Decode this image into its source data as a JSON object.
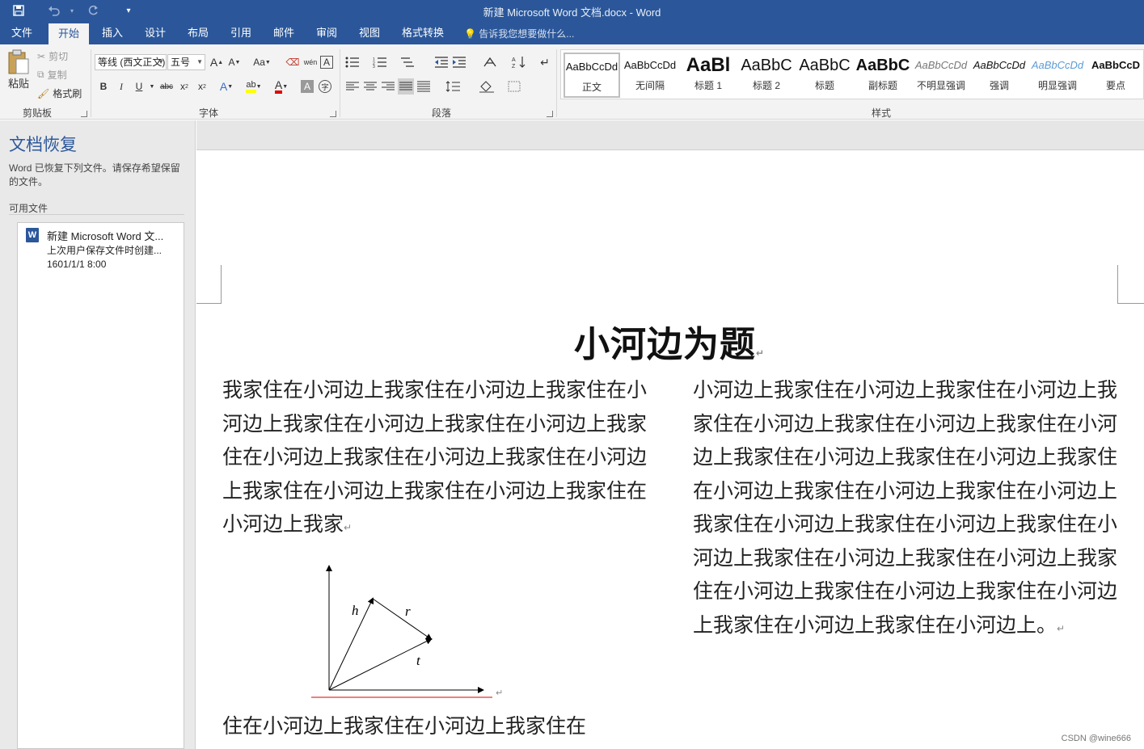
{
  "titlebar": {
    "title": "新建 Microsoft Word 文档.docx - Word",
    "save_icon": "save-icon",
    "undo_icon": "undo-icon",
    "redo_icon": "redo-icon"
  },
  "tabs": [
    "文件",
    "开始",
    "插入",
    "设计",
    "布局",
    "引用",
    "邮件",
    "审阅",
    "视图",
    "格式转换"
  ],
  "tell_me": "告诉我您想要做什么...",
  "ribbon": {
    "clipboard": {
      "label": "剪贴板",
      "paste": "粘贴",
      "cut": "剪切",
      "copy": "复制",
      "format_painter": "格式刷"
    },
    "font": {
      "label": "字体",
      "font_name": "等线 (西文正文)",
      "font_size": "五号",
      "grow": "A",
      "shrink": "A",
      "change_case": "Aa",
      "phonetic": "wén",
      "char_border": "A",
      "bold": "B",
      "italic": "I",
      "underline": "U",
      "strike": "abc",
      "subscript": "x",
      "superscript": "x",
      "highlight": "ab",
      "font_color": "A",
      "char_shading": "A",
      "enclosed": "字"
    },
    "paragraph": {
      "label": "段落"
    },
    "styles": {
      "label": "样式",
      "items": [
        {
          "preview": "AaBbCcDd",
          "name": "正文"
        },
        {
          "preview": "AaBbCcDd",
          "name": "无间隔"
        },
        {
          "preview": "AaBl",
          "name": "标题 1"
        },
        {
          "preview": "AaBbC",
          "name": "标题 2"
        },
        {
          "preview": "AaBbC",
          "name": "标题"
        },
        {
          "preview": "AaBbC",
          "name": "副标题"
        },
        {
          "preview": "AaBbCcDd",
          "name": "不明显强调"
        },
        {
          "preview": "AaBbCcDd",
          "name": "强调"
        },
        {
          "preview": "AaBbCcDd",
          "name": "明显强调"
        },
        {
          "preview": "AaBbCcD",
          "name": "要点"
        }
      ]
    }
  },
  "recovery": {
    "title": "文档恢复",
    "description": "Word 已恢复下列文件。请保存希望保留的文件。",
    "available_label": "可用文件",
    "file": {
      "name": "新建 Microsoft Word 文...",
      "status": "上次用户保存文件时创建...",
      "date": "1601/1/1 8:00"
    }
  },
  "document": {
    "title": "小河边为题",
    "col1_text": "我家住在小河边上我家住在小河边上我家住在小河边上我家住在小河边上我家住在小河边上我家住在小河边上我家住在小河边上我家住在小河边上我家住在小河边上我家住在小河边上我家住在小河边上我家",
    "col1_bottom": "住在小河边上我家住在小河边上我家住在",
    "col2_text": "小河边上我家住在小河边上我家住在小河边上我家住在小河边上我家住在小河边上我家住在小河边上我家住在小河边上我家住在小河边上我家住在小河边上我家住在小河边上我家住在小河边上我家住在小河边上我家住在小河边上我家住在小河边上我家住在小河边上我家住在小河边上我家住在小河边上我家住在小河边上我家住在小河边上我家住在小河边上我家住在小河边上。",
    "diagram_labels": {
      "h": "h",
      "r": "r",
      "t": "t"
    }
  },
  "watermark": "CSDN @wine666",
  "colors": {
    "brand": "#2b579a",
    "ribbon": "#f3f3f3",
    "pane": "#e9e9e9"
  }
}
